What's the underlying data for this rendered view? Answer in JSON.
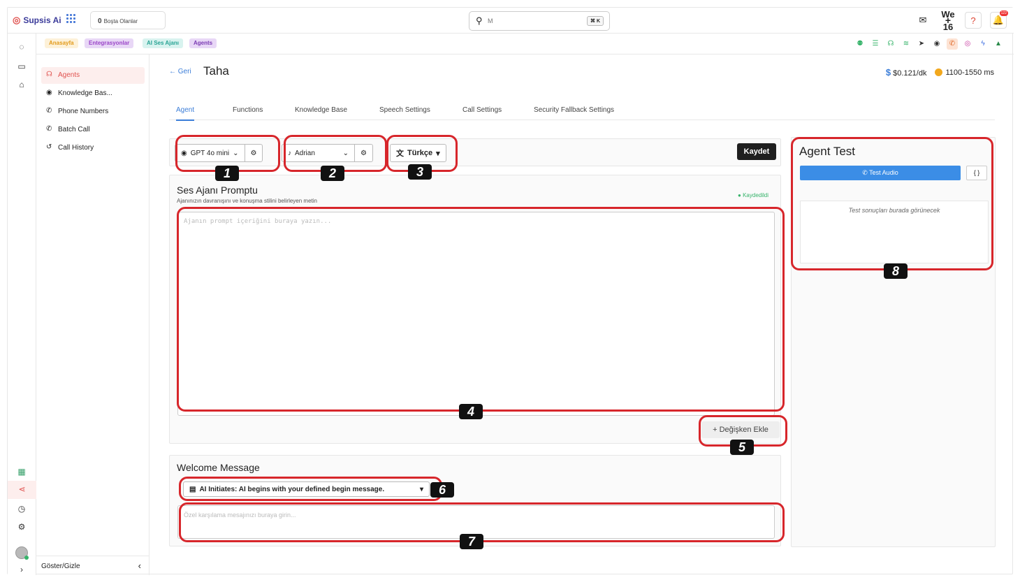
{
  "app": {
    "name": "Supsis Ai"
  },
  "topbar": {
    "idle_count": "0",
    "idle_label": "Boşta Olanlar",
    "search_value": "M",
    "shortcut": "⌘ K",
    "we_label": "We",
    "we_number": "16",
    "notif_count": "122"
  },
  "breadcrumb": [
    "Anasayfa",
    "Entegrasyonlar",
    "AI Ses Ajanı",
    "Agents"
  ],
  "sidebar": {
    "items": [
      {
        "label": "Agents",
        "icon": "headset-icon"
      },
      {
        "label": "Knowledge Bas...",
        "icon": "bulb-icon"
      },
      {
        "label": "Phone Numbers",
        "icon": "phone-icon"
      },
      {
        "label": "Batch Call",
        "icon": "phone-icon"
      },
      {
        "label": "Call History",
        "icon": "history-icon"
      }
    ],
    "footer": "Göster/Gizle"
  },
  "header": {
    "back": "Geri",
    "title": "Taha",
    "price": "$0.121/dk",
    "latency": "1100-1550 ms"
  },
  "tabs": [
    "Agent",
    "Functions",
    "Knowledge Base",
    "Speech Settings",
    "Call Settings",
    "Security Fallback Settings"
  ],
  "controls": {
    "model": "GPT 4o mini",
    "voice": "Adrian",
    "language": "Türkçe",
    "save": "Kaydet"
  },
  "prompt": {
    "title": "Ses Ajanı Promptu",
    "subtitle": "Ajanınızın davranışını ve konuşma stilini belirleyen metin",
    "saved": "Kaydedildi",
    "placeholder": "Ajanın prompt içeriğini buraya yazın...",
    "add_variable": "Değişken Ekle"
  },
  "welcome": {
    "title": "Welcome Message",
    "mode": "AI Initiates: AI begins with your defined begin message.",
    "placeholder": "Özel karşılama mesajınızı buraya girin..."
  },
  "test": {
    "title": "Agent Test",
    "button": "Test Audio",
    "code": "{ }",
    "result": "Test sonuçları burada görünecek"
  },
  "markers": [
    "1",
    "2",
    "3",
    "4",
    "5",
    "6",
    "7",
    "8"
  ],
  "colors": {
    "accent": "#3b7dd8",
    "brand_red": "#e0524f",
    "annotation": "#d7262b"
  }
}
